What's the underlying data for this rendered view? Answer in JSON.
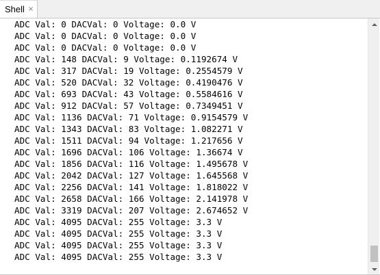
{
  "tab": {
    "label": "Shell",
    "close_glyph": "×"
  },
  "output_lines": [
    "ADC Val: 0 DACVal: 0 Voltage: 0.0 V",
    "ADC Val: 0 DACVal: 0 Voltage: 0.0 V",
    "ADC Val: 0 DACVal: 0 Voltage: 0.0 V",
    "ADC Val: 148 DACVal: 9 Voltage: 0.1192674 V",
    "ADC Val: 317 DACVal: 19 Voltage: 0.2554579 V",
    "ADC Val: 520 DACVal: 32 Voltage: 0.4190476 V",
    "ADC Val: 693 DACVal: 43 Voltage: 0.5584616 V",
    "ADC Val: 912 DACVal: 57 Voltage: 0.7349451 V",
    "ADC Val: 1136 DACVal: 71 Voltage: 0.9154579 V",
    "ADC Val: 1343 DACVal: 83 Voltage: 1.082271 V",
    "ADC Val: 1511 DACVal: 94 Voltage: 1.217656 V",
    "ADC Val: 1696 DACVal: 106 Voltage: 1.36674 V",
    "ADC Val: 1856 DACVal: 116 Voltage: 1.495678 V",
    "ADC Val: 2042 DACVal: 127 Voltage: 1.645568 V",
    "ADC Val: 2256 DACVal: 141 Voltage: 1.818022 V",
    "ADC Val: 2658 DACVal: 166 Voltage: 2.141978 V",
    "ADC Val: 3319 DACVal: 207 Voltage: 2.674652 V",
    "ADC Val: 4095 DACVal: 255 Voltage: 3.3 V",
    "ADC Val: 4095 DACVal: 255 Voltage: 3.3 V",
    "ADC Val: 4095 DACVal: 255 Voltage: 3.3 V",
    "ADC Val: 4095 DACVal: 255 Voltage: 3.3 V"
  ],
  "icons": {
    "close": "close-icon",
    "scroll_up": "arrow-up-icon",
    "scroll_down": "arrow-down-icon"
  }
}
